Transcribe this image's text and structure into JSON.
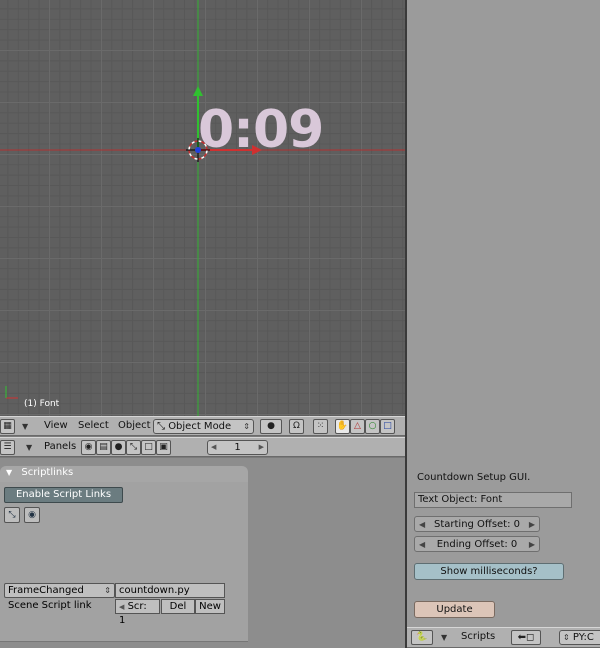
{
  "viewport": {
    "object_text": "0:09",
    "status": "(1) Font"
  },
  "view3d_header": {
    "menu_view": "View",
    "menu_select": "Select",
    "menu_object": "Object",
    "mode_select": "Object Mode"
  },
  "buttons_header": {
    "panels_label": "Panels",
    "frame_value": "1"
  },
  "scriptlinks_panel": {
    "title": "Scriptlinks",
    "enable_button": "Enable Script Links",
    "event_select": "FrameChanged",
    "script_name": "countdown.py",
    "scene_label": "Scene Script link",
    "scr_field": "Scr: 1",
    "del_button": "Del",
    "new_button": "New"
  },
  "script_gui": {
    "title": "Countdown Setup GUI.",
    "text_object_field": "Text Object: Font",
    "starting_offset": "Starting Offset: 0",
    "ending_offset": "Ending Offset: 0",
    "show_ms_button": "Show milliseconds?",
    "update_button": "Update"
  },
  "scripts_header": {
    "label": "Scripts",
    "script_select": "PY:C"
  },
  "colors": {
    "text_object": "#d9c8d9",
    "x_axis": "#b03030",
    "y_axis": "#30b030"
  }
}
